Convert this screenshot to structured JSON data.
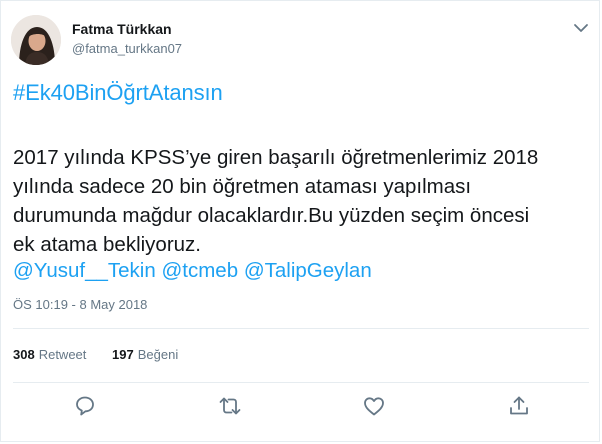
{
  "user": {
    "name": "Fatma Türkkan",
    "handle": "@fatma_turkkan07"
  },
  "tweet": {
    "hashtag": "#Ek40BinÖğrtAtansın",
    "lines": [
      "2017 yılında KPSS’ye giren başarılı öğretmenlerimiz 2018",
      "yılında sadece 20 bin öğretmen ataması yapılması",
      "durumunda mağdur olacaklardır.Bu yüzden seçim öncesi",
      "ek atama bekliyoruz."
    ],
    "mentions": [
      "@Yusuf__Tekin",
      "@tcmeb",
      "@TalipGeylan"
    ],
    "timestamp": "ÖS 10:19 - 8 May 2018"
  },
  "stats": {
    "retweets_count": "308",
    "retweets_label": "Retweet",
    "likes_count": "197",
    "likes_label": "Beğeni"
  },
  "actions": {
    "reply_icon": "reply-icon",
    "retweet_icon": "retweet-icon",
    "like_icon": "heart-icon",
    "share_icon": "share-icon"
  },
  "colors": {
    "link": "#1da1f2",
    "secondary_text": "#657786",
    "primary_text": "#14171a",
    "divider": "#e6ecf0"
  }
}
